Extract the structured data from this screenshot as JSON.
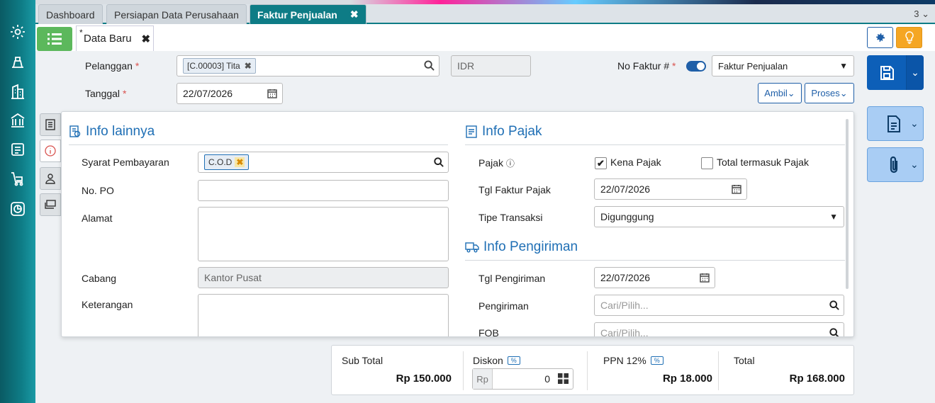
{
  "tabs": [
    {
      "label": "Dashboard"
    },
    {
      "label": "Persiapan Data Perusahaan"
    },
    {
      "label": "Faktur Penjualan"
    }
  ],
  "tab_count": "3",
  "doc_tab": {
    "label": "Data Baru",
    "modified_marker": "*"
  },
  "form": {
    "pelanggan_label": "Pelanggan",
    "pelanggan_value": "[C.00003] Tita",
    "currency": "IDR",
    "tanggal_label": "Tanggal",
    "tanggal_value": "22/07/2026",
    "no_faktur_label": "No Faktur #",
    "faktur_type": "Faktur Penjualan",
    "ambil_label": "Ambil",
    "proses_label": "Proses"
  },
  "info_lainnya": {
    "title": "Info lainnya",
    "syarat_label": "Syarat Pembayaran",
    "syarat_value": "C.O.D",
    "no_po_label": "No. PO",
    "alamat_label": "Alamat",
    "cabang_label": "Cabang",
    "cabang_value": "Kantor Pusat",
    "keterangan_label": "Keterangan"
  },
  "info_pajak": {
    "title": "Info Pajak",
    "pajak_label": "Pajak",
    "kena_pajak_label": "Kena Pajak",
    "kena_pajak_checked": true,
    "termasuk_label": "Total termasuk Pajak",
    "termasuk_checked": false,
    "tgl_faktur_label": "Tgl Faktur Pajak",
    "tgl_faktur_value": "22/07/2026",
    "tipe_label": "Tipe Transaksi",
    "tipe_value": "Digunggung"
  },
  "info_pengiriman": {
    "title": "Info Pengiriman",
    "tgl_label": "Tgl Pengiriman",
    "tgl_value": "22/07/2026",
    "pengiriman_label": "Pengiriman",
    "pengiriman_placeholder": "Cari/Pilih...",
    "fob_label": "FOB",
    "fob_placeholder": "Cari/Pilih..."
  },
  "totals": {
    "subtotal_label": "Sub Total",
    "subtotal_value": "Rp 150.000",
    "diskon_label": "Diskon",
    "diskon_pct": "%",
    "diskon_prefix": "Rp",
    "diskon_value": "0",
    "ppn_label": "PPN 12%",
    "ppn_pct": "%",
    "ppn_value": "Rp 18.000",
    "total_label": "Total",
    "total_value": "Rp 168.000"
  },
  "colors": {
    "sidebar": "#0e7c86",
    "active_tab": "#0e7c86",
    "menu_button": "#5cb85c",
    "save_button": "#0d5fb8",
    "heading_blue": "#1f6fb5",
    "lightbulb": "#f5a623"
  },
  "icons": [
    "gear-icon",
    "cart-icon",
    "building-icon",
    "bank-icon",
    "factory-icon",
    "trolley-icon",
    "chart-icon",
    "list-icon",
    "close-icon",
    "search-icon",
    "calendar-icon",
    "save-icon",
    "document-icon",
    "paperclip-icon",
    "info-icon",
    "lightbulb-icon",
    "truck-icon"
  ]
}
